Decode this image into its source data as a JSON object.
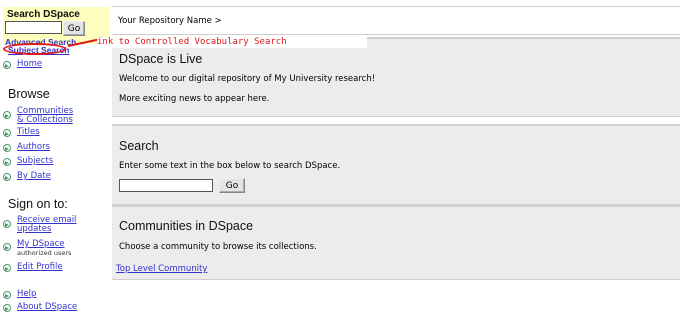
{
  "sidebar": {
    "search_title": "Search DSpace",
    "search_input_value": "",
    "go_label": "Go",
    "advanced_search": "Advanced Search",
    "subject_search": "Subject Search",
    "home": "Home",
    "browse_heading": "Browse",
    "browse_items": [
      "Communities",
      "& Collections",
      "Titles",
      "Authors",
      "Subjects",
      "By Date"
    ],
    "sign_on_heading": "Sign on to:",
    "sign_items": [
      "Receive email",
      "updates",
      "My DSpace",
      "authorized users",
      "Edit Profile"
    ],
    "help_items": [
      "Help",
      "About DSpace"
    ]
  },
  "annotation": "ink to Controlled Vocabulary Search",
  "breadcrumb": "Your Repository Name >",
  "panels": {
    "live": {
      "title": "DSpace is Live",
      "line1": "Welcome to our digital repository of My University research!",
      "line2": "More exciting news to appear here."
    },
    "search": {
      "title": "Search",
      "text": "Enter some text in the box below to search DSpace.",
      "input_value": "",
      "go_label": "Go"
    },
    "communities": {
      "title": "Communities in DSpace",
      "text": "Choose a community to browse its collections.",
      "link": "Top Level Community"
    }
  },
  "colors": {
    "link": "#3333cc",
    "search_box_bg": "#fdfdbd",
    "panel_bg": "#ececec",
    "annotation": "#e01818"
  }
}
